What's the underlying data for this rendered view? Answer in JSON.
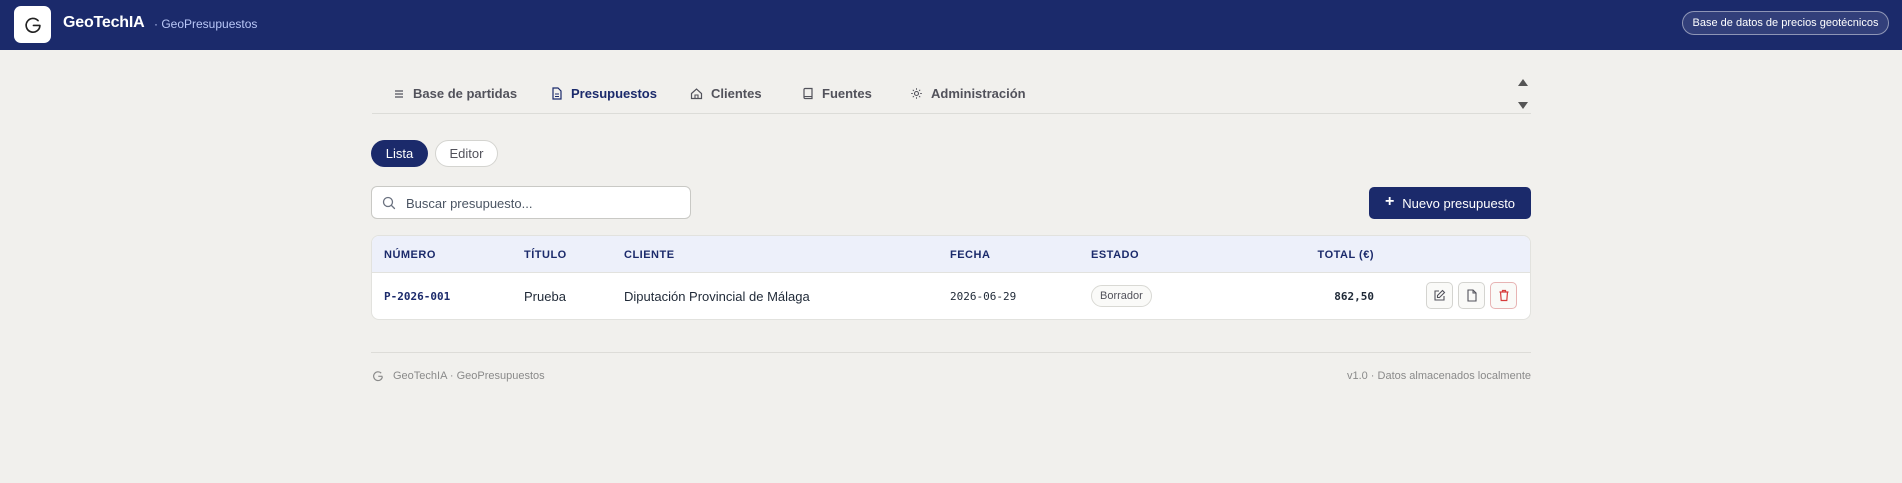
{
  "header": {
    "brand": "GeoTechIA",
    "subtitle": "· GeoPresupuestos",
    "price_db_button": "Base de datos de precios geotécnicos"
  },
  "tabs": [
    {
      "label": "Base de partidas",
      "icon": "list-icon"
    },
    {
      "label": "Presupuestos",
      "icon": "document-icon",
      "active": true
    },
    {
      "label": "Clientes",
      "icon": "home-icon"
    },
    {
      "label": "Fuentes",
      "icon": "book-icon"
    },
    {
      "label": "Administración",
      "icon": "gear-icon"
    }
  ],
  "view_toggle": {
    "list": "Lista",
    "editor": "Editor",
    "selected": "Lista"
  },
  "search": {
    "placeholder": "Buscar presupuesto...",
    "value": ""
  },
  "new_button": {
    "plus": "+",
    "label": "Nuevo presupuesto"
  },
  "table": {
    "columns": [
      "NÚMERO",
      "TÍTULO",
      "CLIENTE",
      "FECHA",
      "ESTADO",
      "TOTAL (€)"
    ],
    "rows": [
      {
        "numero": "P-2026-001",
        "titulo": "Prueba",
        "cliente": "Diputación Provincial de Málaga",
        "fecha": "2026-06-29",
        "estado": "Borrador",
        "total": "862,50"
      }
    ]
  },
  "footer": {
    "left": "GeoTechIA · GeoPresupuestos",
    "right": "v1.0 · Datos almacenados localmente"
  },
  "colors": {
    "primary": "#1b2a6b",
    "background": "#f1f0ed",
    "danger": "#d63b3b"
  }
}
